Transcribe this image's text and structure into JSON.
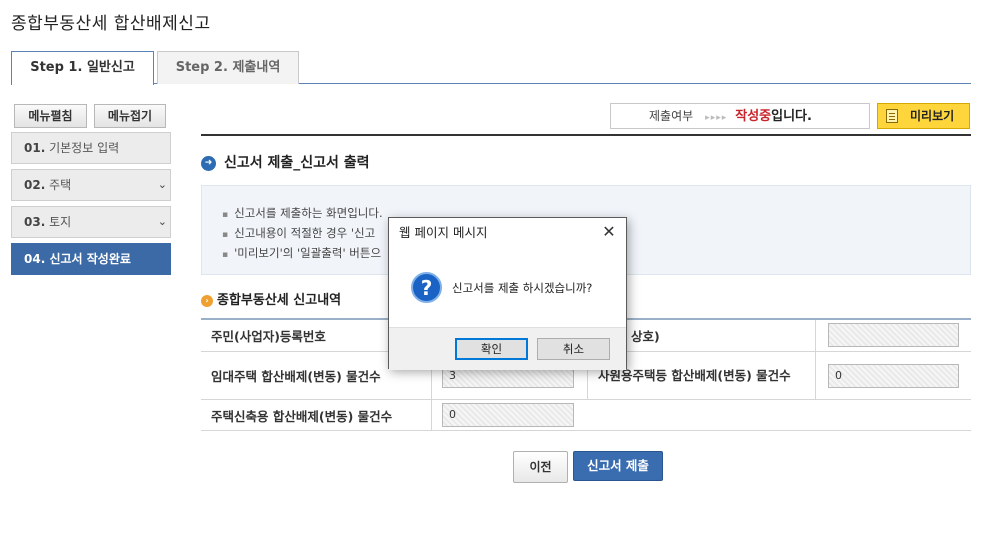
{
  "page": {
    "title": "종합부동산세 합산배제신고"
  },
  "tabs": [
    {
      "label": "Step 1. 일반신고",
      "active": true
    },
    {
      "label": "Step 2. 제출내역",
      "active": false
    }
  ],
  "menu": {
    "open_label": "메뉴펼침",
    "close_label": "메뉴접기"
  },
  "sidebar": {
    "items": [
      {
        "num": "01.",
        "label": "기본정보 입력",
        "chevron": ""
      },
      {
        "num": "02.",
        "label": "주택",
        "chevron": "⌄"
      },
      {
        "num": "03.",
        "label": "토지",
        "chevron": "⌄"
      },
      {
        "num": "04.",
        "label": "신고서 작성완료",
        "chevron": ""
      }
    ]
  },
  "status": {
    "label": "제출여부",
    "arrows": "▸▸▸▸",
    "highlight": "작성중",
    "suffix": "입니다."
  },
  "preview": {
    "label": "미리보기"
  },
  "section": {
    "title": "신고서 제출_신고서 출력",
    "info": [
      "신고서를 제출하는 화면입니다.",
      "신고내용이 적절한 경우 '신고",
      "'미리보기'의 '일괄출력' 버튼으"
    ]
  },
  "summary": {
    "title": "종합부동산세 신고내역",
    "rows": [
      {
        "label1": "주민(사업자)등록번호",
        "label2": "상호)",
        "value2": ""
      },
      {
        "label1": "임대주택 합산배제(변동) 물건수",
        "value1": "3",
        "label2": "사원용주택등 합산배제(변동) 물건수",
        "value2": "0"
      },
      {
        "label1": "주택신축용 합산배제(변동) 물건수",
        "value1": "0"
      }
    ]
  },
  "actions": {
    "prev_label": "이전",
    "submit_label": "신고서 제출"
  },
  "dialog": {
    "title": "웹 페이지 메시지",
    "close": "✕",
    "icon": "?",
    "message": "신고서를 제출 하시겠습니까?",
    "ok_label": "확인",
    "cancel_label": "취소"
  },
  "colors": {
    "accent_blue": "#3b6aa6",
    "status_red": "#c8242b",
    "preview_yellow": "#fed63c",
    "dialog_focus": "#0078d7"
  }
}
